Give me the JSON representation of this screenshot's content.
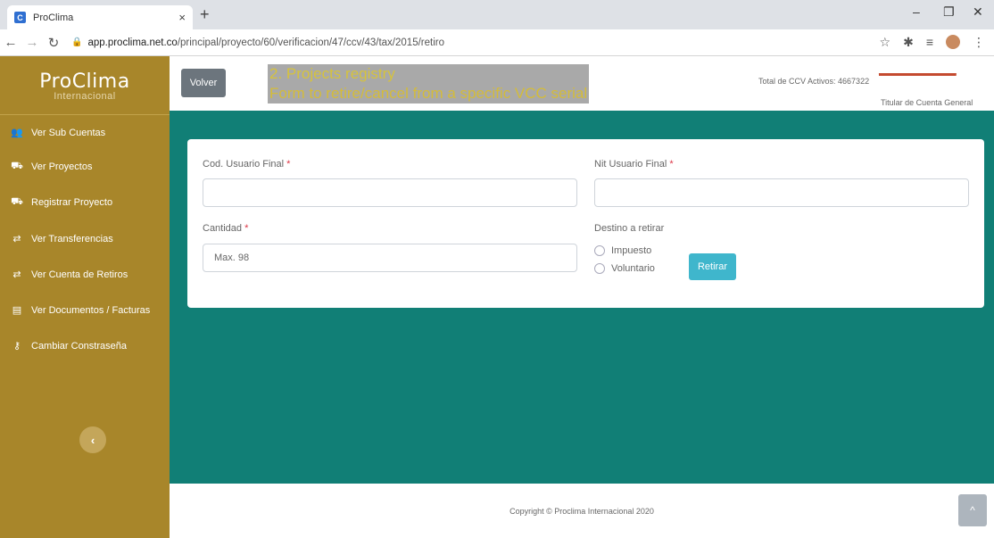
{
  "browser": {
    "tab_title": "ProClima",
    "tab_favicon": "C",
    "tab_close": "×",
    "new_tab": "+",
    "minimize": "–",
    "restore": "❐",
    "close": "✕",
    "url_host": "app.proclima.net.co",
    "url_path": "/principal/proyecto/60/verificacion/47/ccv/43/tax/2015/retiro"
  },
  "sidebar": {
    "logo_main": "ProClima",
    "logo_sub": "Internacional",
    "items": [
      {
        "label": "Ver Sub Cuentas",
        "icon": "users-icon",
        "glyph": "👥"
      },
      {
        "label": "Ver Proyectos",
        "icon": "hand-holding-icon",
        "glyph": "⛟"
      },
      {
        "label": "Registrar Proyecto",
        "icon": "hand-holding-icon",
        "glyph": "⛟"
      },
      {
        "label": "Ver Transferencias",
        "icon": "exchange-icon",
        "glyph": "⇄"
      },
      {
        "label": "Ver Cuenta de Retiros",
        "icon": "exchange-icon",
        "glyph": "⇄"
      },
      {
        "label": "Ver Documentos / Facturas",
        "icon": "document-icon",
        "glyph": "▤"
      },
      {
        "label": "Cambiar Constraseña",
        "icon": "key-icon",
        "glyph": "⚷"
      }
    ],
    "collapse_glyph": "‹"
  },
  "header": {
    "back_label": "Volver",
    "annotation_line1": "2. Projects registry",
    "annotation_line2": "Form to retire/cancel from a specific VCC serial",
    "total_ccv": "Total de CCV Activos: 4667322",
    "account_role": "Titular de Cuenta General"
  },
  "form": {
    "cod_usuario_label": "Cod. Usuario Final",
    "nit_usuario_label": "Nit Usuario Final",
    "cantidad_label": "Cantidad",
    "cantidad_placeholder": "Max. 98",
    "destino_label": "Destino a retirar",
    "required_mark": "*",
    "options": [
      "Impuesto",
      "Voluntario"
    ],
    "submit_label": "Retirar"
  },
  "footer": {
    "copyright": "Copyright © Proclima Internacional 2020",
    "scroll_top_glyph": "^"
  },
  "colors": {
    "sidebar": "#a8862a",
    "content": "#117f76",
    "submit": "#3fb6cc",
    "back_button": "#6c757d"
  }
}
